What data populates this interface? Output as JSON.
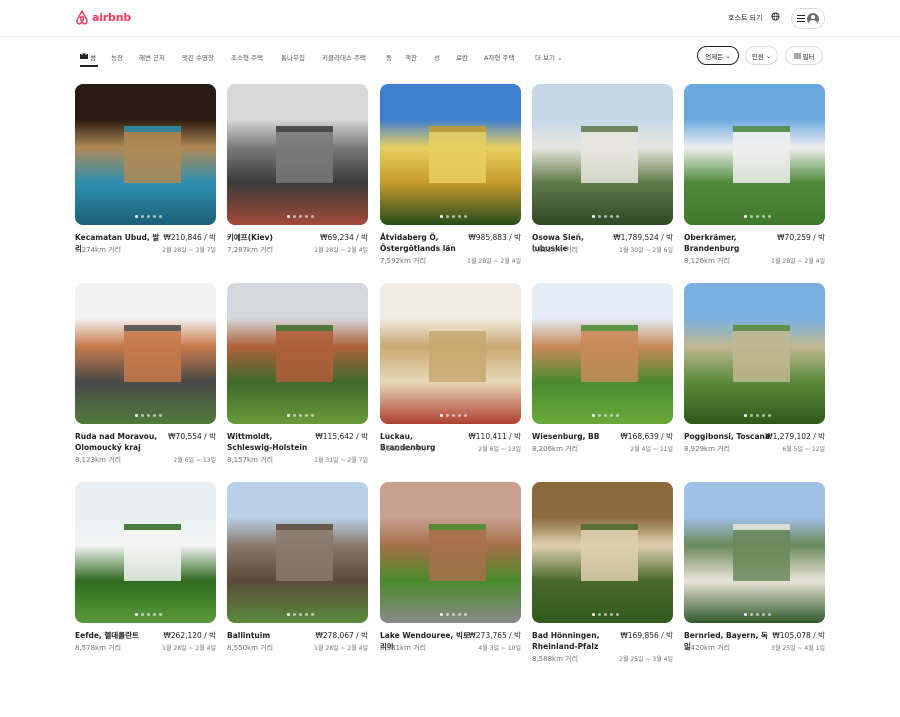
{
  "header": {
    "logo_text": "airbnb",
    "host_link": "호스트 되기"
  },
  "categories": [
    "성",
    "농장",
    "해변 근처",
    "멋진 수영장",
    "초소형 주택",
    "통나무집",
    "키클라데스 주택",
    "동",
    "객잔",
    "성",
    "료칸",
    "A자형 주택",
    "더 보기"
  ],
  "filters": {
    "flexible": "언제든",
    "guests": "인원",
    "filter": "필터"
  },
  "listings": [
    {
      "title": "Kecamatan Ubud, 발리",
      "price": "₩210,846 / 박",
      "distance": "5,274km 거리",
      "dates": "2월 28일 ~ 3월 7일",
      "colors": [
        "#2a1a12",
        "#b08a55",
        "#2f8fb0",
        "#1b5f78"
      ]
    },
    {
      "title": "키예프(Kiev)",
      "price": "₩69,234 / 박",
      "distance": "7,287km 거리",
      "dates": "1월 28일 ~ 2월 4일",
      "colors": [
        "#d8d8d8",
        "#7a7a7a",
        "#3a3a3a",
        "#a44a3a"
      ]
    },
    {
      "title": "Åtvidaberg Ö, Östergötlands län",
      "price": "₩985,883 / 박",
      "distance": "7,592km 거리",
      "dates": "1월 28일 ~ 2월 4일",
      "colors": [
        "#3f7fd0",
        "#e8d060",
        "#c79a2a",
        "#274d1a"
      ]
    },
    {
      "title": "Osowa Sień, lubuskie",
      "price": "₩1,789,524 / 박",
      "distance": "8,022km 거리",
      "dates": "1월 30일 ~ 2월 6일",
      "colors": [
        "#c6d8e8",
        "#e8e6e0",
        "#5f7a4a",
        "#2f4a26"
      ]
    },
    {
      "title": "Oberkrämer, Brandenburg",
      "price": "₩70,259 / 박",
      "distance": "8,126km 거리",
      "dates": "1월 28일 ~ 2월 4일",
      "colors": [
        "#6aa8e0",
        "#f0f0f0",
        "#4f8a3a",
        "#3f7a2a"
      ]
    },
    {
      "title": "Ruda nad Moravou, Olomoucký kraj",
      "price": "₩70,554 / 박",
      "distance": "8,123km 거리",
      "dates": "2월 6일 ~ 13일",
      "colors": [
        "#f2f2f2",
        "#c87a4a",
        "#4a4a4a",
        "#4f7a3a"
      ]
    },
    {
      "title": "Wittmoldt, Schleswig-Holstein",
      "price": "₩115,642 / 박",
      "distance": "8,157km 거리",
      "dates": "1월 31일 ~ 2월 7일",
      "colors": [
        "#d4d8dc",
        "#b0603a",
        "#3f6a2a",
        "#6a9a3a"
      ]
    },
    {
      "title": "Luckau, Brandenburg",
      "price": "₩110,411 / 박",
      "distance": "8,162km 거리",
      "dates": "2월 6일 ~ 13일",
      "colors": [
        "#f0ebe3",
        "#c8a870",
        "#e8d8b8",
        "#b04030"
      ]
    },
    {
      "title": "Wiesenburg, BB",
      "price": "₩168,639 / 박",
      "distance": "8,206km 거리",
      "dates": "2월 4일 ~ 11일",
      "colors": [
        "#e4ecf4",
        "#c88a5a",
        "#4a8a30",
        "#6aaa3a"
      ]
    },
    {
      "title": "Poggibonsi, Toscana",
      "price": "₩1,279,102 / 박",
      "distance": "8,929km 거리",
      "dates": "6월 5일 ~ 12일",
      "colors": [
        "#7ab0e0",
        "#c0b890",
        "#5a8a3a",
        "#2f5a1a"
      ]
    },
    {
      "title": "Eefde, 헬데를란트",
      "price": "₩262,120 / 박",
      "distance": "8,578km 거리",
      "dates": "1월 28일 ~ 2월 4일",
      "colors": [
        "#e8f0f4",
        "#f4f4f4",
        "#2f6a1f",
        "#5a9a3a"
      ]
    },
    {
      "title": "Ballintuim",
      "price": "₩278,067 / 박",
      "distance": "8,550km 거리",
      "dates": "1월 28일 ~ 2월 4일",
      "colors": [
        "#b8d0e8",
        "#8a7a6a",
        "#5a4a3a",
        "#5a8a3a"
      ]
    },
    {
      "title": "Lake Wendouree, 빅토리아",
      "price": "₩273,765 / 박",
      "distance": "8,531km 거리",
      "dates": "4월 3일 ~ 10일",
      "colors": [
        "#c8a090",
        "#a8704a",
        "#4a8a2a",
        "#8a8a8a"
      ]
    },
    {
      "title": "Bad Hönningen, Rheinland-Pfalz",
      "price": "₩169,856 / 박",
      "distance": "8,588km 거리",
      "dates": "2월 25일 ~ 3월 4일",
      "colors": [
        "#8a6a3a",
        "#e0d0b0",
        "#4a6a2a",
        "#2f5a1a"
      ]
    },
    {
      "title": "Bernried, Bayern, 독일",
      "price": "₩105,078 / 박",
      "distance": "8,420km 거리",
      "dates": "3월 25일 ~ 4월 1일",
      "colors": [
        "#a0c0e8",
        "#6a8a5a",
        "#e8e4d8",
        "#2f5a2a"
      ]
    }
  ]
}
